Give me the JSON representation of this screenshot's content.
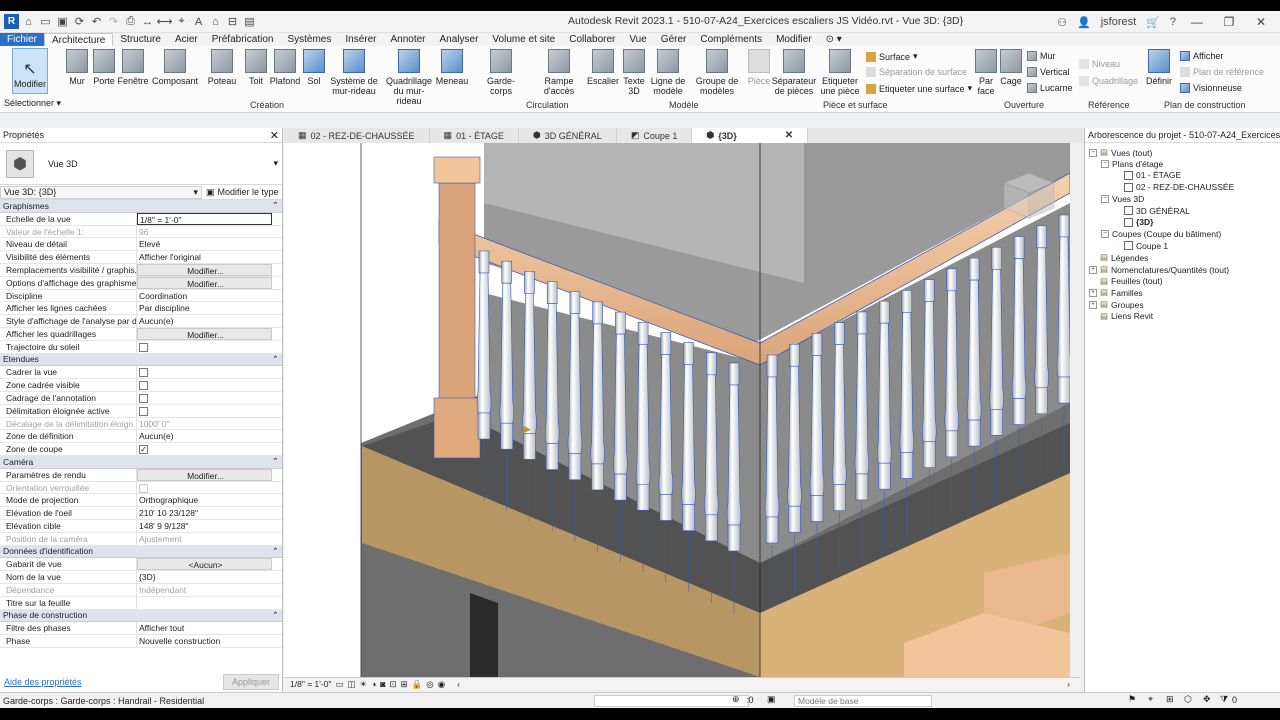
{
  "app": {
    "title": "Autodesk Revit 2023.1 - 510-07-A24_Exercices escaliers JS Vidéo.rvt - Vue 3D: {3D}",
    "user": "jsforest",
    "logo": "R"
  },
  "menu": {
    "tabs": [
      "Fichier",
      "Architecture",
      "Structure",
      "Acier",
      "Préfabrication",
      "Systèmes",
      "Insérer",
      "Annoter",
      "Analyser",
      "Volume et site",
      "Collaborer",
      "Vue",
      "Gérer",
      "Compléments",
      "Modifier"
    ],
    "active": "Architecture"
  },
  "ribbon": {
    "modify": "Modifier",
    "select": "Sélectionner",
    "build": [
      {
        "label": "Mur",
        "icon": "wall-icon"
      },
      {
        "label": "Porte",
        "icon": "door-icon"
      },
      {
        "label": "Fenêtre",
        "icon": "window-icon"
      },
      {
        "label": "Composant",
        "icon": "component-icon"
      },
      {
        "label": "Poteau",
        "icon": "column-icon"
      },
      {
        "label": "Toit",
        "icon": "roof-icon"
      },
      {
        "label": "Plafond",
        "icon": "ceiling-icon"
      },
      {
        "label": "Sol",
        "icon": "floor-icon"
      },
      {
        "label": "Système de mur-rideau",
        "icon": "curtain-system-icon"
      },
      {
        "label": "Quadrillage du mur-rideau",
        "icon": "curtain-grid-icon"
      },
      {
        "label": "Meneau",
        "icon": "mullion-icon"
      }
    ],
    "circulation": [
      {
        "label": "Garde-corps",
        "icon": "railing-icon"
      },
      {
        "label": "Rampe d'accès",
        "icon": "ramp-icon"
      },
      {
        "label": "Escalier",
        "icon": "stair-icon"
      }
    ],
    "model": [
      {
        "label": "Texte 3D",
        "icon": "model-text-icon"
      },
      {
        "label": "Ligne de modèle",
        "icon": "model-line-icon"
      },
      {
        "label": "Groupe de modèles",
        "icon": "model-group-icon"
      }
    ],
    "room": [
      {
        "label": "Pièce",
        "icon": "room-icon"
      },
      {
        "label": "Séparateur de pièces",
        "icon": "room-separator-icon"
      },
      {
        "label": "Etiqueter une pièce",
        "icon": "tag-room-icon"
      }
    ],
    "room_small": [
      "Surface",
      "Séparation de surface",
      "Etiqueter une surface"
    ],
    "openings": [
      {
        "label": "Par face",
        "icon": "by-face-icon"
      },
      {
        "label": "Cage",
        "icon": "shaft-icon"
      }
    ],
    "openings_small": [
      "Mur",
      "Vertical",
      "Lucarne"
    ],
    "datum_small": [
      "Niveau",
      "Quadrillage"
    ],
    "work_plane": {
      "label": "Définir",
      "icon": "set-plane-icon"
    },
    "work_plane_small": [
      "Afficher",
      "Plan de référence",
      "Visionneuse"
    ],
    "groups": {
      "build": "Création",
      "circulation": "Circulation",
      "model": "Modèle",
      "room": "Pièce et surface",
      "openings": "Ouverture",
      "datum": "Référence",
      "work_plane": "Plan de construction"
    }
  },
  "properties": {
    "title": "Propriétés",
    "type_name": "Vue 3D",
    "instance": "Vue 3D: {3D}",
    "edit_type": "Modifier le type",
    "sections": [
      {
        "name": "Graphismes",
        "rows": [
          {
            "k": "Echelle de la vue",
            "v": "1/8\" = 1'-0\"",
            "kind": "box"
          },
          {
            "k": "Valeur de l'échelle    1:",
            "v": "96",
            "kind": "dim"
          },
          {
            "k": "Niveau de détail",
            "v": "Elevé"
          },
          {
            "k": "Visibilité des éléments",
            "v": "Afficher l'original"
          },
          {
            "k": "Remplacements visibilité / graphis...",
            "v": "Modifier...",
            "kind": "btn"
          },
          {
            "k": "Options d'affichage des graphismes",
            "v": "Modifier...",
            "kind": "btn"
          },
          {
            "k": "Discipline",
            "v": "Coordination"
          },
          {
            "k": "Afficher les lignes cachées",
            "v": "Par discipline"
          },
          {
            "k": "Style d'affichage de l'analyse par d...",
            "v": "Aucun(e)"
          },
          {
            "k": "Afficher les quadrillages",
            "v": "Modifier...",
            "kind": "btn"
          },
          {
            "k": "Trajectoire du soleil",
            "v": "",
            "kind": "check",
            "checked": false
          }
        ]
      },
      {
        "name": "Etendues",
        "rows": [
          {
            "k": "Cadrer la vue",
            "v": "",
            "kind": "check",
            "checked": false
          },
          {
            "k": "Zone cadrée visible",
            "v": "",
            "kind": "check",
            "checked": false
          },
          {
            "k": "Cadrage de l'annotation",
            "v": "",
            "kind": "check",
            "checked": false
          },
          {
            "k": "Délimitation éloignée active",
            "v": "",
            "kind": "check",
            "checked": false
          },
          {
            "k": "Décalage de la délimitation éloign...",
            "v": "1000'  0\"",
            "kind": "dim"
          },
          {
            "k": "Zone de définition",
            "v": "Aucun(e)"
          },
          {
            "k": "Zone de coupe",
            "v": "",
            "kind": "check",
            "checked": true
          }
        ]
      },
      {
        "name": "Caméra",
        "rows": [
          {
            "k": "Paramètres de rendu",
            "v": "Modifier...",
            "kind": "btn"
          },
          {
            "k": "Orientation verrouillée",
            "v": "",
            "kind": "dimcheck"
          },
          {
            "k": "Mode de projection",
            "v": "Orthographique"
          },
          {
            "k": "Elévation de l'oeil",
            "v": "210'  10 23/128\""
          },
          {
            "k": "Elévation cible",
            "v": "148'  9 9/128\""
          },
          {
            "k": "Position de la caméra",
            "v": "Ajustement",
            "kind": "dim"
          }
        ]
      },
      {
        "name": "Données d'identification",
        "rows": [
          {
            "k": "Gabarit de vue",
            "v": "<Aucun>",
            "kind": "btn"
          },
          {
            "k": "Nom de la vue",
            "v": "{3D}"
          },
          {
            "k": "Dépendance",
            "v": "Indépendant",
            "kind": "dim"
          },
          {
            "k": "Titre sur la feuille",
            "v": ""
          }
        ]
      },
      {
        "name": "Phase de construction",
        "rows": [
          {
            "k": "Filtre des phases",
            "v": "Afficher tout"
          },
          {
            "k": "Phase",
            "v": "Nouvelle construction"
          }
        ]
      }
    ],
    "help": "Aide des propriétés",
    "apply": "Appliquer"
  },
  "doc_tabs": [
    {
      "label": "02 - REZ-DE-CHAUSSÉE",
      "active": false
    },
    {
      "label": "01 - ÉTAGE",
      "active": false
    },
    {
      "label": "3D GÉNÉRAL",
      "active": false
    },
    {
      "label": "Coupe 1",
      "active": false
    },
    {
      "label": "{3D}",
      "active": true
    }
  ],
  "view_control": {
    "scale": "1/8\" = 1'-0\""
  },
  "browser": {
    "title": "Arborescence du projet - 510-07-A24_Exercices e...",
    "items": [
      {
        "label": "Vues (tout)",
        "level": 0,
        "exp": "−"
      },
      {
        "label": "Plans d'étage",
        "level": 1,
        "exp": "−"
      },
      {
        "label": "01 - ÉTAGE",
        "level": 2,
        "exp": ""
      },
      {
        "label": "02 - REZ-DE-CHAUSSÉE",
        "level": 2,
        "exp": ""
      },
      {
        "label": "Vues 3D",
        "level": 1,
        "exp": "−"
      },
      {
        "label": "3D GÉNÉRAL",
        "level": 2,
        "exp": ""
      },
      {
        "label": "{3D}",
        "level": 2,
        "exp": "",
        "bold": true
      },
      {
        "label": "Coupes (Coupe du bâtiment)",
        "level": 1,
        "exp": "−"
      },
      {
        "label": "Coupe 1",
        "level": 2,
        "exp": ""
      },
      {
        "label": "Légendes",
        "level": 0,
        "exp": ""
      },
      {
        "label": "Nomenclatures/Quantités (tout)",
        "level": 0,
        "exp": "+"
      },
      {
        "label": "Feuilles (tout)",
        "level": 0,
        "exp": ""
      },
      {
        "label": "Familles",
        "level": 0,
        "exp": "+"
      },
      {
        "label": "Groupes",
        "level": 0,
        "exp": "+"
      },
      {
        "label": "Liens Revit",
        "level": 0,
        "exp": ""
      }
    ]
  },
  "status": {
    "text": "Garde-corps : Garde-corps : Handrail - Residential",
    "count": ":0",
    "model": "Modèle de base",
    "filter": "0"
  },
  "colors": {
    "accent": "#2a6fc9",
    "wood": "#e9b88c",
    "selection": "#3b5bb8",
    "grey_mass": "#8a8a8a"
  }
}
